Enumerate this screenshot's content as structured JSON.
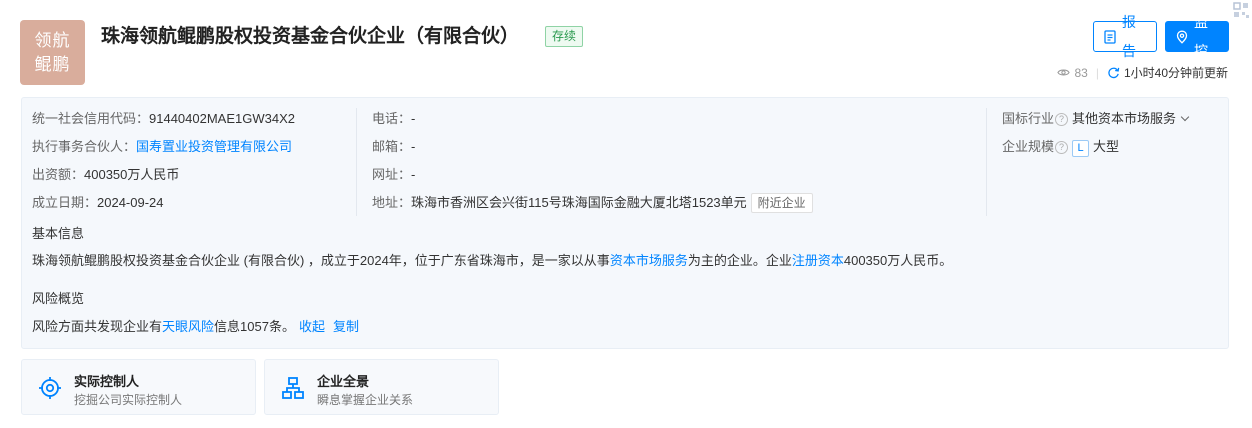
{
  "company": {
    "logo_line1": "领航",
    "logo_line2": "鲲鹏",
    "name": "珠海领航鲲鹏股权投资基金合伙企业（有限合伙）",
    "status": "存续",
    "logo_color": "#d9ad9c"
  },
  "actions": {
    "report_label": "报告",
    "monitor_label": "监控"
  },
  "meta": {
    "views": "83",
    "updated": "1小时40分钟前更新"
  },
  "info": {
    "credit_code_label": "统一社会信用代码：",
    "credit_code": "91440402MAE1GW34X2",
    "partner_label": "执行事务合伙人：",
    "partner": "国寿置业投资管理有限公司",
    "capital_label": "出资额：",
    "capital": "400350万人民币",
    "founded_label": "成立日期：",
    "founded": "2024-09-24",
    "phone_label": "电话：",
    "phone": "-",
    "email_label": "邮箱：",
    "email": "-",
    "website_label": "网址：",
    "website": "-",
    "address_label": "地址：",
    "address": "珠海市香洲区会兴街115号珠海国际金融大厦北塔1523单元",
    "nearby_label": "附近企业",
    "industry_label": "国标行业",
    "industry": "其他资本市场服务",
    "scale_label": "企业规模",
    "scale_tag": "L",
    "scale": "大型"
  },
  "basic": {
    "title": "基本信息",
    "text_1": "珠海领航鲲鹏股权投资基金合伙企业 (有限合伙) ，成立于2024年，位于广东省珠海市，是一家以从事",
    "link_1": "资本市场服务",
    "text_2": "为主的企业。企业",
    "link_2": "注册资本",
    "text_3": "400350万人民币。"
  },
  "risk": {
    "title": "风险概览",
    "text_1": "风险方面共发现企业有",
    "link_1": "天眼风险",
    "text_2": "信息1057条。",
    "collapse": "收起",
    "copy": "复制"
  },
  "cards": [
    {
      "title": "实际控制人",
      "subtitle": "挖掘公司实际控制人",
      "icon": "target-icon"
    },
    {
      "title": "企业全景",
      "subtitle": "瞬息掌握企业关系",
      "icon": "org-chart-icon"
    }
  ],
  "colors": {
    "accent": "#0084ff",
    "status_green": "#2b9a4f"
  }
}
